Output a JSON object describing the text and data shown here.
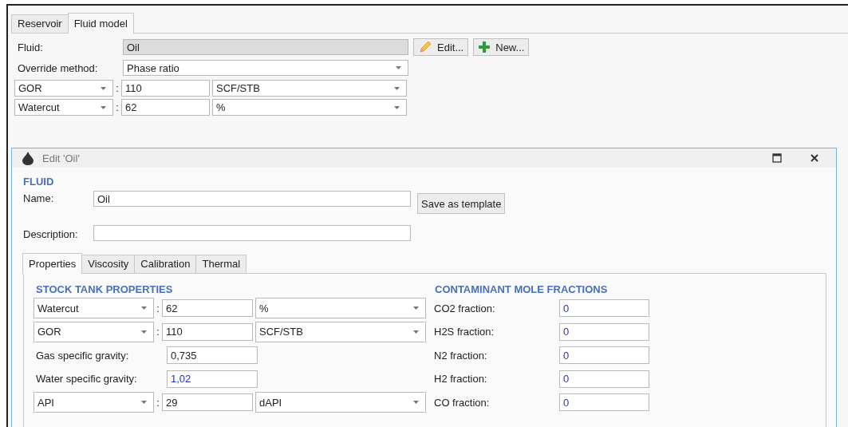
{
  "tabs": [
    {
      "label": "Reservoir",
      "selected": false
    },
    {
      "label": "Fluid model",
      "selected": true
    }
  ],
  "fluid": {
    "label": "Fluid:",
    "value": "Oil",
    "buttons": [
      {
        "kind": "edit",
        "label": "Edit..."
      },
      {
        "kind": "new",
        "label": "New..."
      }
    ]
  },
  "override": {
    "label": "Override method:",
    "value": "Phase ratio"
  },
  "ratios": [
    {
      "quantity": "GOR",
      "separator": ":",
      "value": "110",
      "unit": "SCF/STB"
    },
    {
      "quantity": "Watercut",
      "separator": ":",
      "value": "62",
      "unit": "%"
    }
  ],
  "dialog": {
    "title": "Edit 'Oil'",
    "section": "FLUID",
    "name": {
      "label": "Name:",
      "value": "Oil"
    },
    "save_button": "Save as template",
    "description": {
      "label": "Description:"
    },
    "tabs": [
      {
        "label": "Properties",
        "selected": true
      },
      {
        "label": "Viscosity",
        "selected": false
      },
      {
        "label": "Calibration",
        "selected": false
      },
      {
        "label": "Thermal",
        "selected": false
      }
    ],
    "stock": {
      "heading": "STOCK TANK PROPERTIES",
      "rows": [
        {
          "kind": "combo",
          "quantity": "Watercut",
          "separator": ":",
          "value": "62",
          "unit": "%",
          "highlighted": false
        },
        {
          "kind": "combo",
          "quantity": "GOR",
          "separator": ":",
          "value": "110",
          "unit": "SCF/STB",
          "highlighted": false
        },
        {
          "kind": "plain",
          "label": "Gas specific gravity:",
          "value": "0,735",
          "highlighted": false
        },
        {
          "kind": "plain",
          "label": "Water specific gravity:",
          "value": "1,02",
          "highlighted": true
        },
        {
          "kind": "combo",
          "quantity": "API",
          "separator": ":",
          "value": "29",
          "unit": "dAPI",
          "highlighted": false
        }
      ]
    },
    "contaminants": {
      "heading": "CONTAMINANT MOLE FRACTIONS",
      "rows": [
        {
          "label": "CO2 fraction:",
          "value": "0",
          "highlighted": true
        },
        {
          "label": "H2S fraction:",
          "value": "0",
          "highlighted": true
        },
        {
          "label": "N2 fraction:",
          "value": "0",
          "highlighted": true
        },
        {
          "label": "H2 fraction:",
          "value": "0",
          "highlighted": true
        },
        {
          "label": "CO fraction:",
          "value": "0",
          "highlighted": true
        }
      ]
    }
  }
}
